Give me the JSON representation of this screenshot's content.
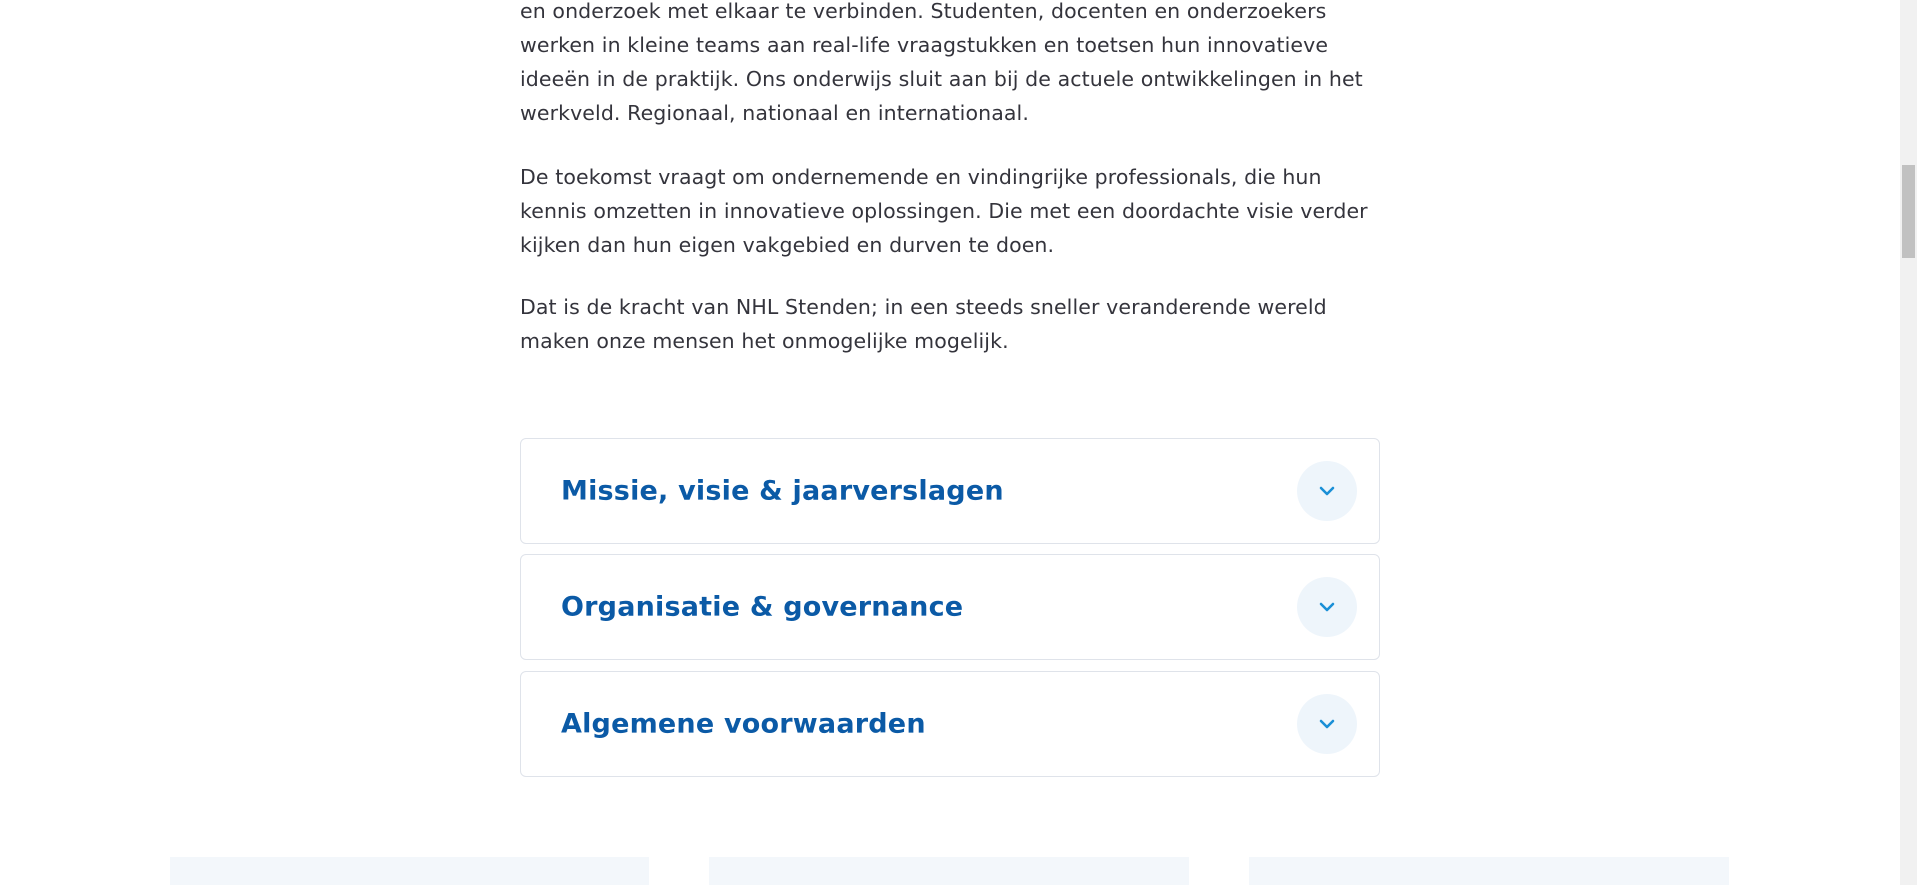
{
  "intro": {
    "paragraph1": [
      "en onderzoek met elkaar te verbinden. Studenten, docenten en onderzoekers",
      "werken in kleine teams aan real-life vraagstukken en toetsen hun innovatieve",
      "ideeën in de praktijk. Ons onderwijs sluit aan bij de actuele ontwikkelingen in het",
      "werkveld. Regionaal, nationaal en internationaal."
    ],
    "paragraph2": [
      "De toekomst vraagt om ondernemende en vindingrijke professionals, die hun",
      "kennis omzetten in innovatieve oplossingen. Die met een doordachte visie verder",
      "kijken dan hun eigen vakgebied en durven te doen."
    ],
    "paragraph3": [
      "Dat is de kracht van NHL Stenden; in een steeds sneller veranderende wereld",
      "maken onze mensen het onmogelijke mogelijk."
    ]
  },
  "accordion": {
    "items": [
      {
        "title": "Missie, visie & jaarverslagen",
        "icon": "chevron-down-icon"
      },
      {
        "title": "Organisatie & governance",
        "icon": "chevron-down-icon"
      },
      {
        "title": "Algemene voorwaarden",
        "icon": "chevron-down-icon"
      }
    ]
  },
  "colors": {
    "text": "#34343c",
    "accent": "#0b5aa6",
    "chevron": "#1a8fd6",
    "toggle_bg": "#eef5fb",
    "border": "#dfe3ea",
    "card_bg": "#f3f7fb"
  }
}
